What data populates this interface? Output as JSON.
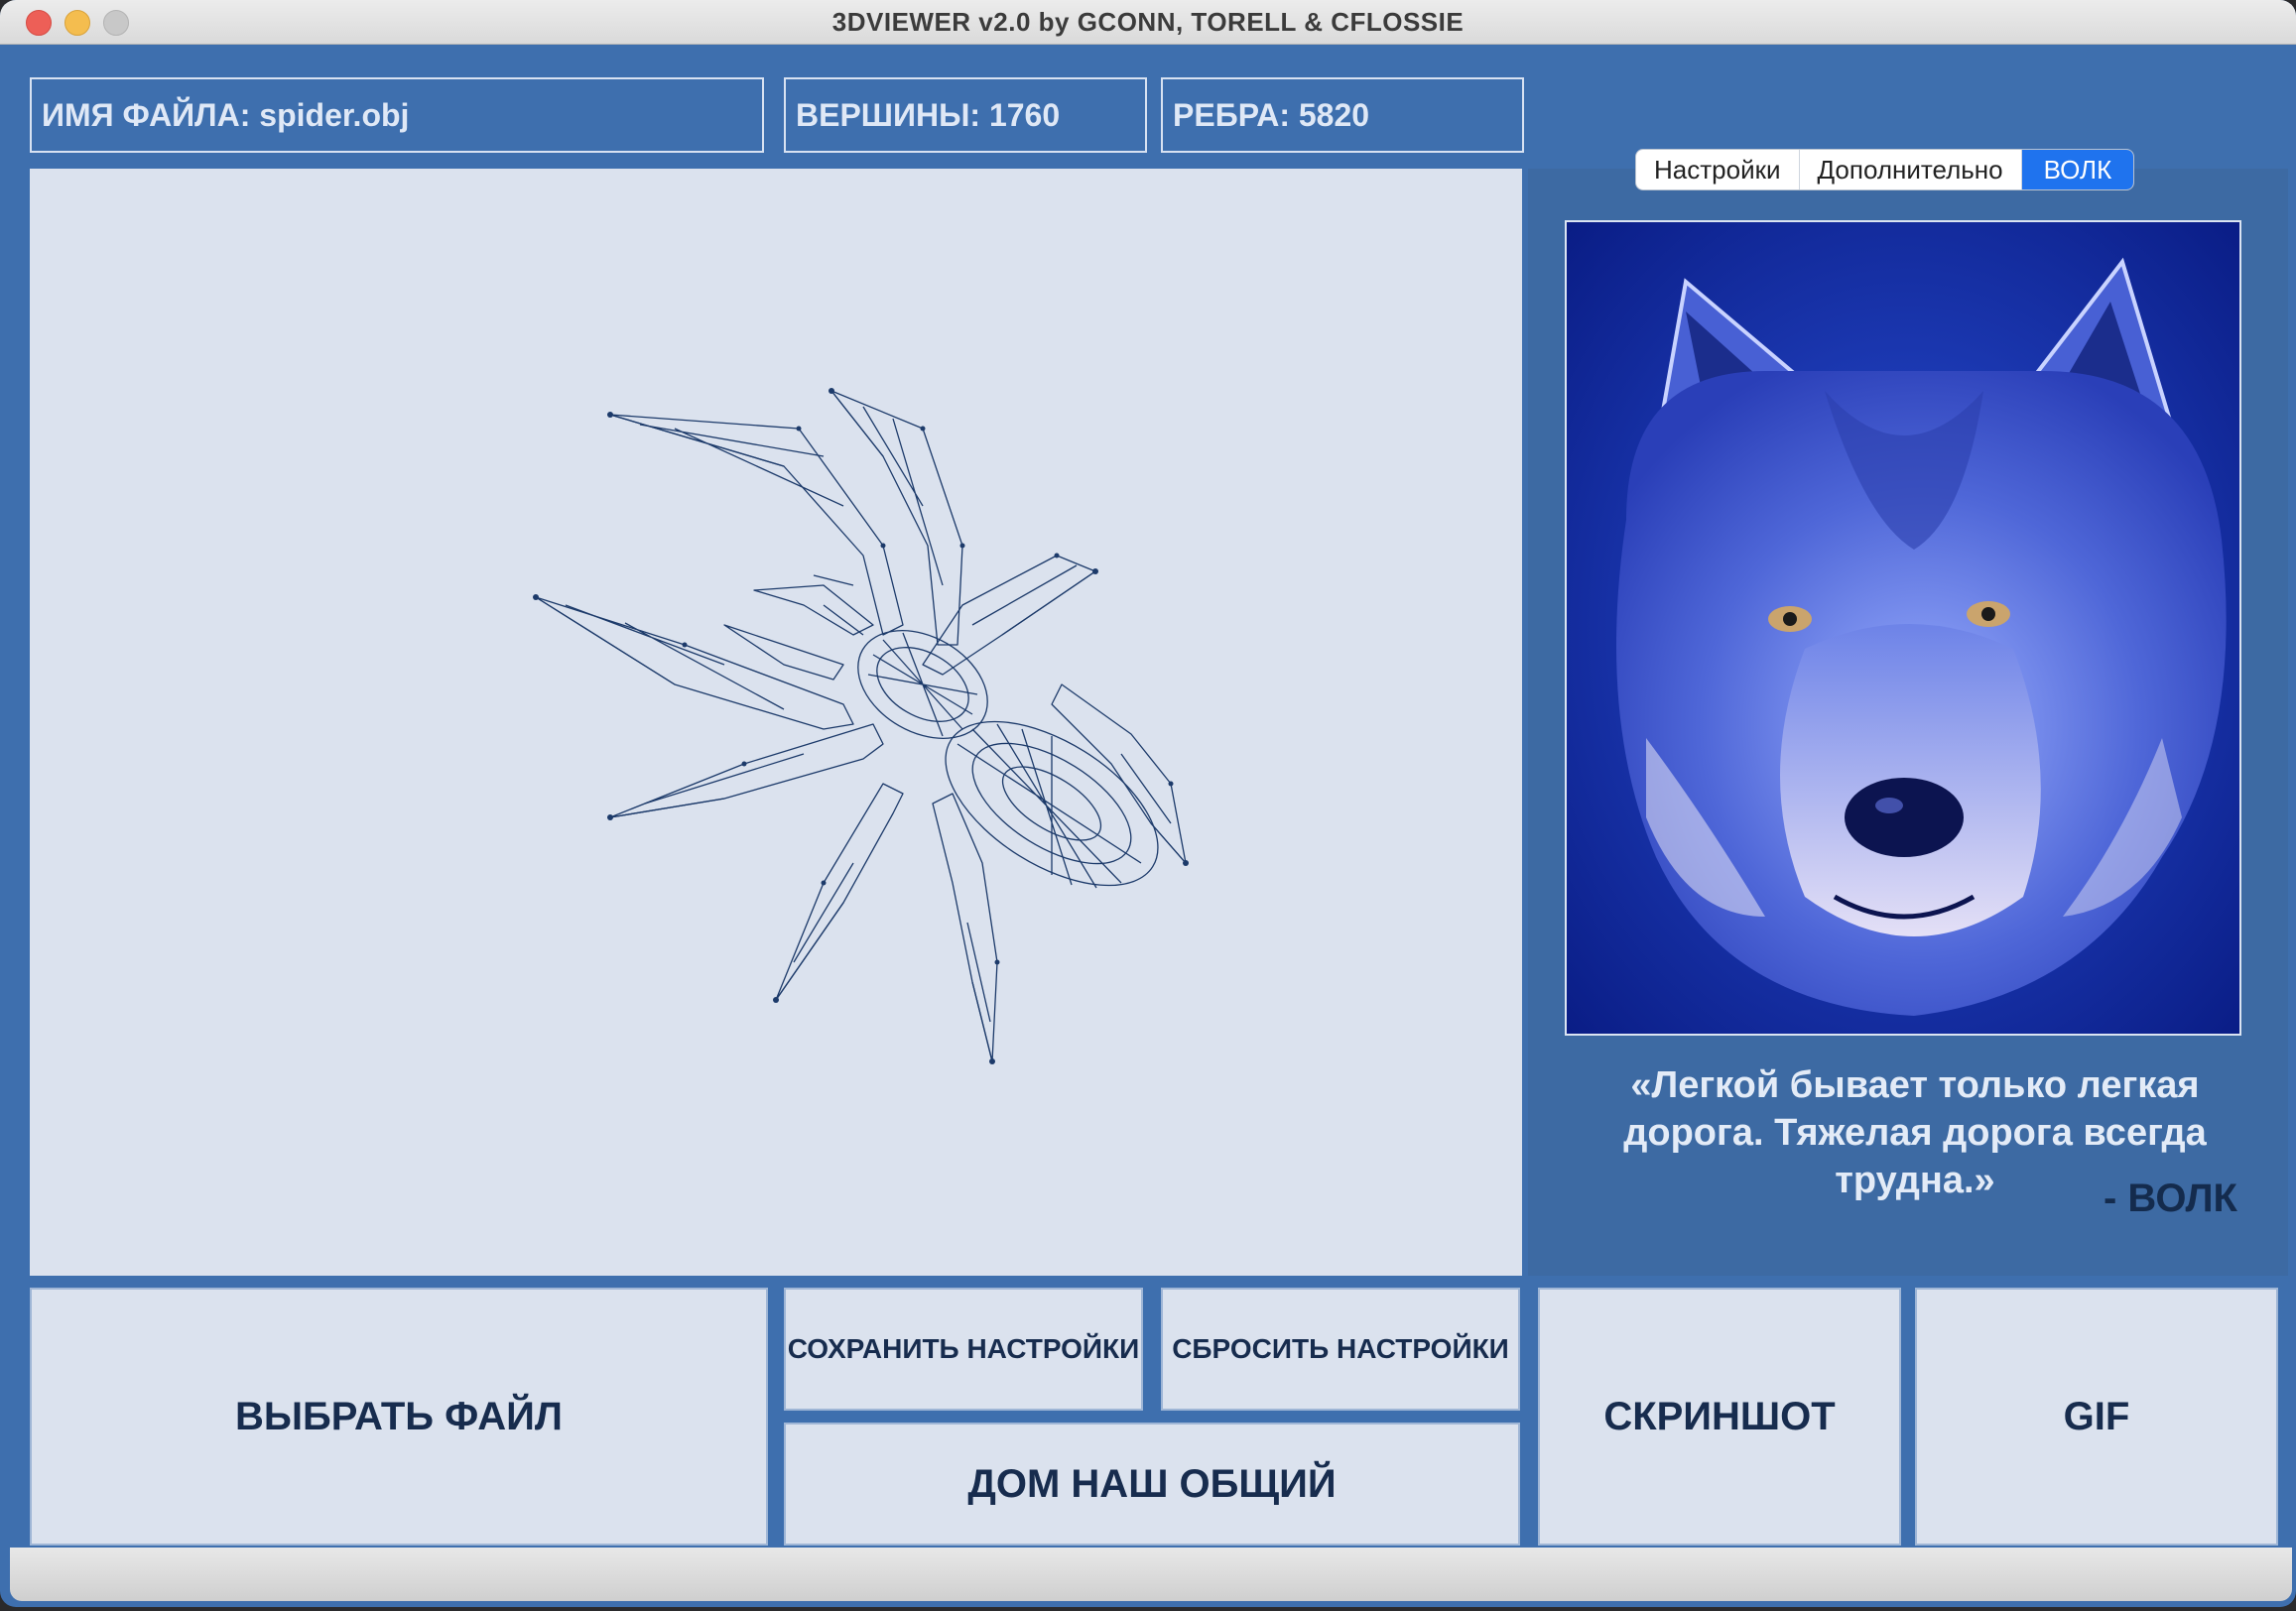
{
  "window": {
    "title": "3DVIEWER v2.0 by GCONN, TORELL & CFLOSSIE"
  },
  "info": {
    "filename": "ИМЯ ФАЙЛА: spider.obj",
    "vertices": "ВЕРШИНЫ: 1760",
    "edges": "РЕБРА: 5820"
  },
  "tabs": [
    {
      "label": "Настройки",
      "active": false
    },
    {
      "label": "Дополнительно",
      "active": false
    },
    {
      "label": "ВОЛК",
      "active": true
    }
  ],
  "wolf_panel": {
    "quote": "«Легкой бывает только легкая дорога. Тяжелая дорога всегда трудна.»",
    "author": "- ВОЛК"
  },
  "buttons": {
    "choose_file": "ВЫБРАТЬ ФАЙЛ",
    "save_settings": "СОХРАНИТЬ НАСТРОЙКИ",
    "reset_settings": "СБРОСИТЬ НАСТРОЙКИ",
    "our_home": "ДОМ НАШ ОБЩИЙ",
    "screenshot": "СКРИНШОТ",
    "gif": "GIF"
  },
  "colors": {
    "window_bg": "#3e6fae",
    "viewport_bg": "#dbe2ee",
    "wireframe": "#1c3a6a",
    "active_tab": "#1f73ee"
  },
  "icons": [
    "close-icon",
    "minimize-icon",
    "maximize-icon"
  ]
}
